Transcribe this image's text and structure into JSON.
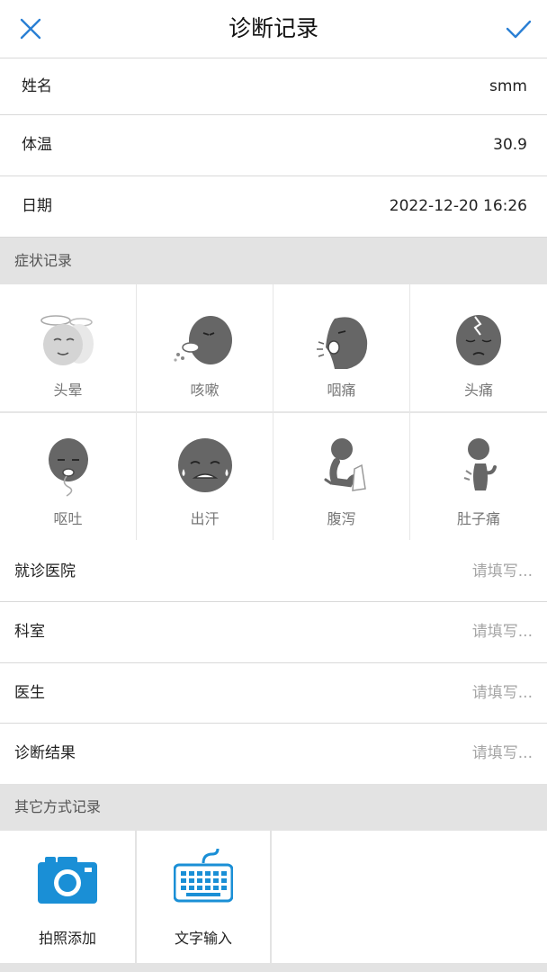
{
  "header": {
    "title": "诊断记录",
    "close_icon": "close-icon",
    "confirm_icon": "check-icon",
    "accent": "#2a7fd4"
  },
  "info": [
    {
      "label": "姓名",
      "value": "smm"
    },
    {
      "label": "体温",
      "value": "30.9"
    },
    {
      "label": "日期",
      "value": "2022-12-20 16:26"
    }
  ],
  "symptoms": {
    "section_title": "症状记录",
    "items": [
      {
        "label": "头晕",
        "icon": "dizzy-face-icon"
      },
      {
        "label": "咳嗽",
        "icon": "cough-face-icon"
      },
      {
        "label": "咽痛",
        "icon": "sore-throat-face-icon"
      },
      {
        "label": "头痛",
        "icon": "headache-face-icon"
      },
      {
        "label": "呕吐",
        "icon": "vomit-face-icon"
      },
      {
        "label": "出汗",
        "icon": "sweat-face-icon"
      },
      {
        "label": "腹泻",
        "icon": "diarrhea-figure-icon"
      },
      {
        "label": "肚子痛",
        "icon": "stomachache-figure-icon"
      }
    ]
  },
  "details": [
    {
      "label": "就诊医院",
      "placeholder": "请填写..."
    },
    {
      "label": "科室",
      "placeholder": "请填写..."
    },
    {
      "label": "医生",
      "placeholder": "请填写..."
    },
    {
      "label": "诊断结果",
      "placeholder": "请填写..."
    }
  ],
  "other": {
    "section_title": "其它方式记录",
    "items": [
      {
        "label": "拍照添加",
        "icon": "camera-icon"
      },
      {
        "label": "文字输入",
        "icon": "keyboard-icon"
      }
    ]
  }
}
